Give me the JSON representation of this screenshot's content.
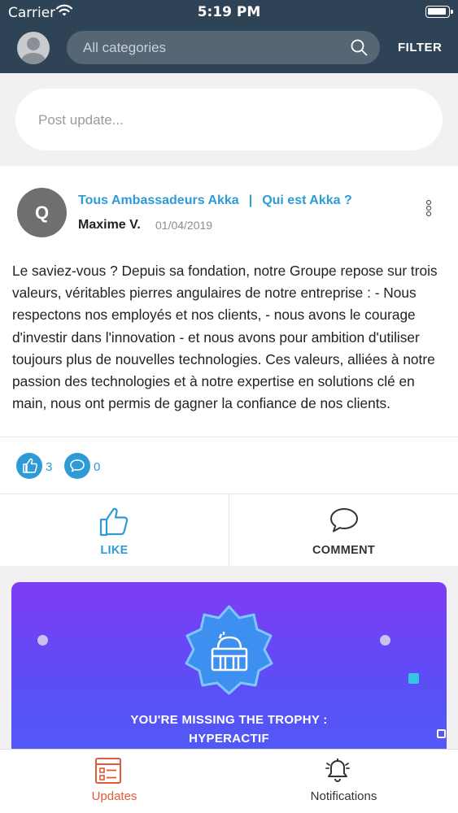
{
  "status_bar": {
    "carrier": "Carrier",
    "time": "5:19 PM"
  },
  "header": {
    "search_placeholder": "All categories",
    "filter_label": "FILTER"
  },
  "composer": {
    "placeholder": "Post update..."
  },
  "post": {
    "avatar_letter": "Q",
    "group_1": "Tous Ambassadeurs Akka",
    "separator": "|",
    "group_2": "Qui est Akka ?",
    "author": "Maxime V.",
    "date": "01/04/2019",
    "body": "Le saviez-vous ? Depuis sa fondation, notre Groupe repose sur trois valeurs, véritables pierres angulaires de notre entreprise : - Nous respectons nos employés et nos clients, - nous avons le courage d'investir dans l'innovation - et nous avons pour ambition d'utiliser toujours plus de nouvelles technologies. Ces valeurs, alliées à notre passion des technologies et à notre expertise en solutions clé en main, nous ont permis de gagner la confiance de nos clients.",
    "like_count": "3",
    "comment_count": "0",
    "like_label": "LIKE",
    "comment_label": "COMMENT"
  },
  "trophy": {
    "line1": "YOU'RE MISSING THE TROPHY :",
    "line2": "HYPERACTIF"
  },
  "tabs": [
    {
      "label": "Updates",
      "icon": "updates-list-icon",
      "active": true
    },
    {
      "label": "Notifications",
      "icon": "bell-icon",
      "active": false
    }
  ],
  "colors": {
    "header_bg": "#2f4356",
    "accent_blue": "#2e9bd6",
    "active_tab": "#e05a38",
    "trophy_gradient_top": "#7f3cf5",
    "trophy_gradient_bottom": "#4e5df5"
  }
}
